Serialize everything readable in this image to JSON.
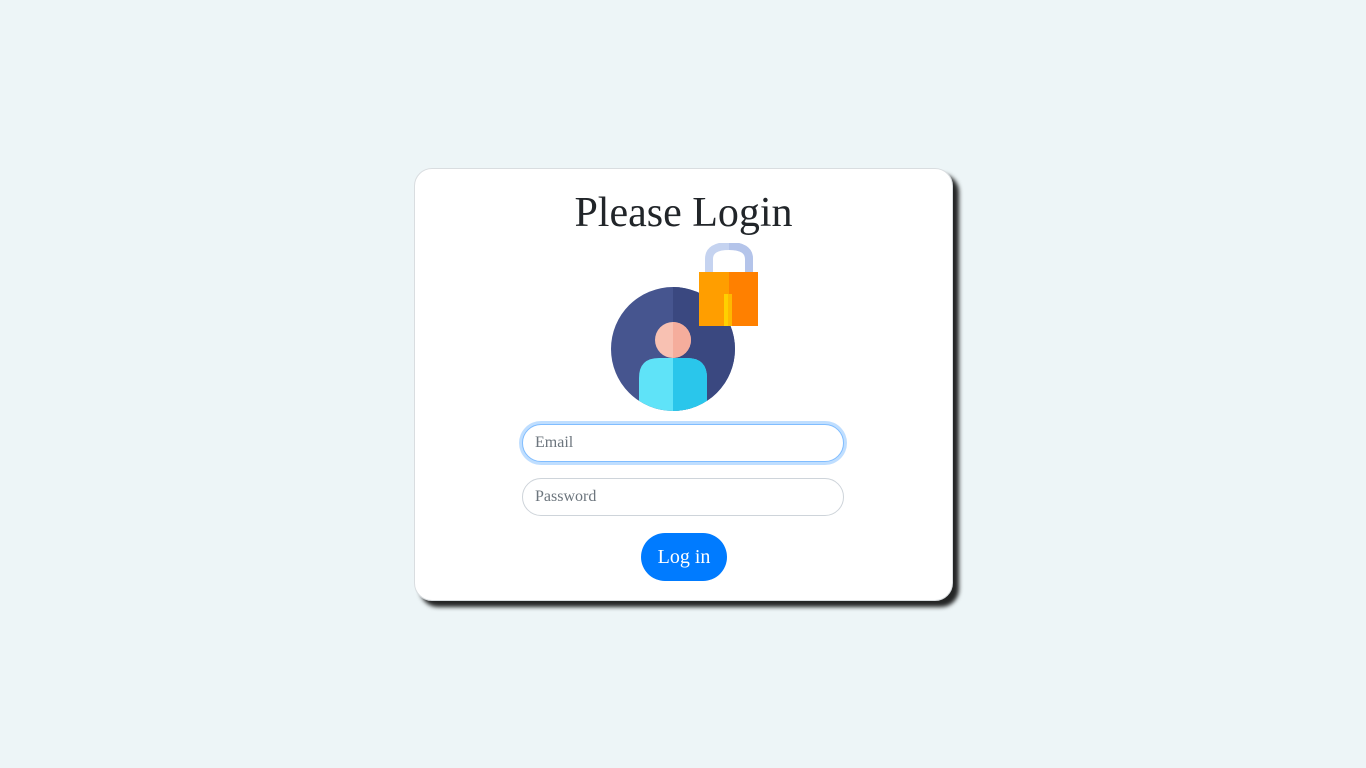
{
  "login": {
    "title": "Please Login",
    "email_placeholder": "Email",
    "email_value": "",
    "password_placeholder": "Password",
    "password_value": "",
    "submit_label": "Log in"
  },
  "icons": {
    "illustration": "user-lock-icon"
  },
  "colors": {
    "page_background": "#edf5f7",
    "card_background": "#ffffff",
    "primary_button": "#007bff",
    "avatar_circle": "#3f4e8a",
    "avatar_body": "#30c9ef",
    "avatar_head": "#f6b1a0",
    "lock_body": "#ff8a00",
    "lock_shackle": "#c4d2f0"
  }
}
